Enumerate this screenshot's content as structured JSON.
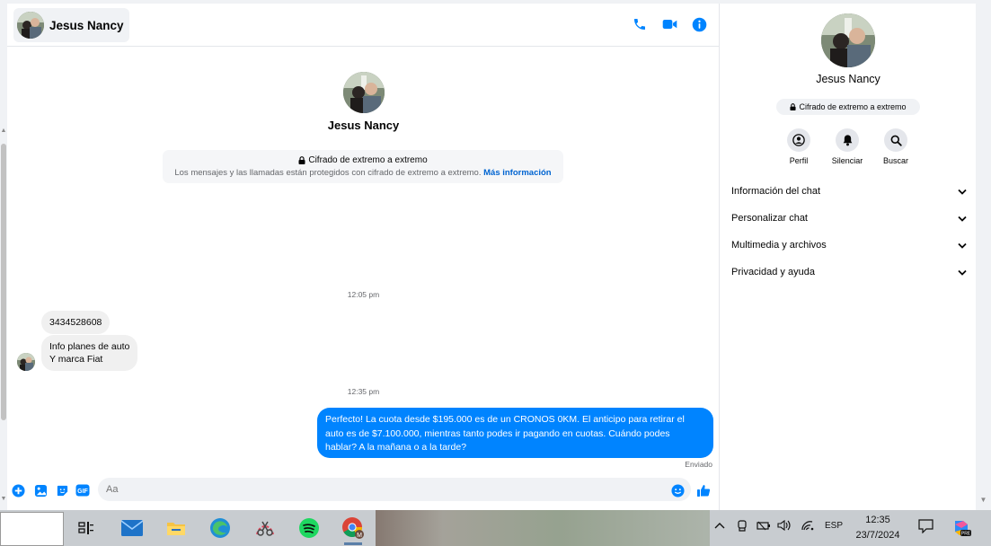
{
  "contact": {
    "name": "Jesus Nancy"
  },
  "intro": {
    "name": "Jesus Nancy",
    "e2e_title": "Cifrado de extremo a extremo",
    "e2e_desc": "Los mensajes y las llamadas están protegidos con cifrado de extremo a extremo.",
    "e2e_link": "Más información"
  },
  "messages": [
    {
      "type": "timestamp",
      "text": "12:05 pm"
    },
    {
      "type": "incoming",
      "text": "3434528608"
    },
    {
      "type": "incoming",
      "lines": [
        "Info planes de auto",
        "Y marca Fiat"
      ]
    },
    {
      "type": "timestamp",
      "text": "12:35 pm"
    },
    {
      "type": "outgoing",
      "lines": [
        "Perfecto! La cuota desde $195.000 es de un CRONOS 0KM. El anticipo para retirar el",
        "auto es de $7.100.000, mientras tanto podes ir pagando en cuotas. Cuándo podes",
        "hablar? A la mañana o a la tarde?"
      ]
    }
  ],
  "status": {
    "sent": "Enviado"
  },
  "composer": {
    "placeholder": "Aa"
  },
  "panel": {
    "name": "Jesus Nancy",
    "e2e_badge": "Cifrado de extremo a extremo",
    "actions": [
      {
        "label": "Perfil",
        "icon": "profile-icon"
      },
      {
        "label": "Silenciar",
        "icon": "bell-icon"
      },
      {
        "label": "Buscar",
        "icon": "search-icon"
      }
    ],
    "sections": [
      {
        "label": "Información del chat"
      },
      {
        "label": "Personalizar chat"
      },
      {
        "label": "Multimedia y archivos"
      },
      {
        "label": "Privacidad y ayuda"
      }
    ]
  },
  "taskbar": {
    "apps": [
      "task-view-icon",
      "mail-icon",
      "file-explorer-icon",
      "edge-icon",
      "snipping-tool-icon",
      "spotify-icon",
      "chrome-icon"
    ],
    "language": "ESP",
    "time": "12:35",
    "date": "23/7/2024"
  },
  "colors": {
    "accent": "#0084ff",
    "link": "#0064d1",
    "bubble_in": "#f0f0f0"
  }
}
